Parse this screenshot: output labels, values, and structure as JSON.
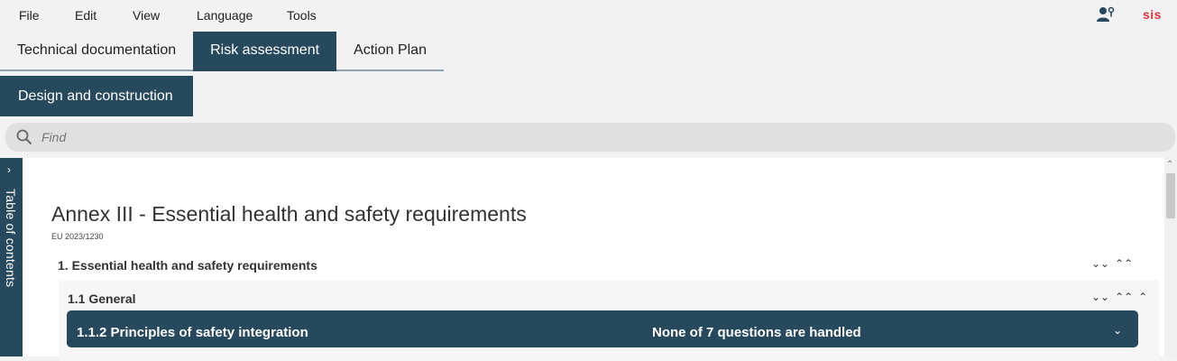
{
  "menu": {
    "items": [
      "File",
      "Edit",
      "View",
      "Language",
      "Tools"
    ],
    "user_icon": "user-settings-icon",
    "brand": "sis"
  },
  "tabs": [
    {
      "label": "Technical documentation",
      "active": false
    },
    {
      "label": "Risk assessment",
      "active": true
    },
    {
      "label": "Action Plan",
      "active": false
    }
  ],
  "subtab": {
    "label": "Design and construction"
  },
  "search": {
    "placeholder": "Find",
    "value": ""
  },
  "toc": {
    "label": "Table of contents",
    "toggle": "›"
  },
  "document": {
    "title": "Annex III - Essential health and safety requirements",
    "subtitle": "EU 2023/1230",
    "section1": {
      "label": "1. Essential health and safety requirements",
      "ctrl": [
        "⌄⌄",
        "⌃⌃"
      ]
    },
    "section11": {
      "label": "1.1 General",
      "ctrl": [
        "⌄⌄",
        "⌃⌃",
        "⌃"
      ]
    },
    "card": {
      "title": "1.1.2 Principles of safety integration",
      "status": "None of 7 questions are handled",
      "chevron": "⌄"
    }
  },
  "colors": {
    "accent": "#26495e",
    "brand": "#d9363e",
    "background": "#f2f2f2"
  }
}
